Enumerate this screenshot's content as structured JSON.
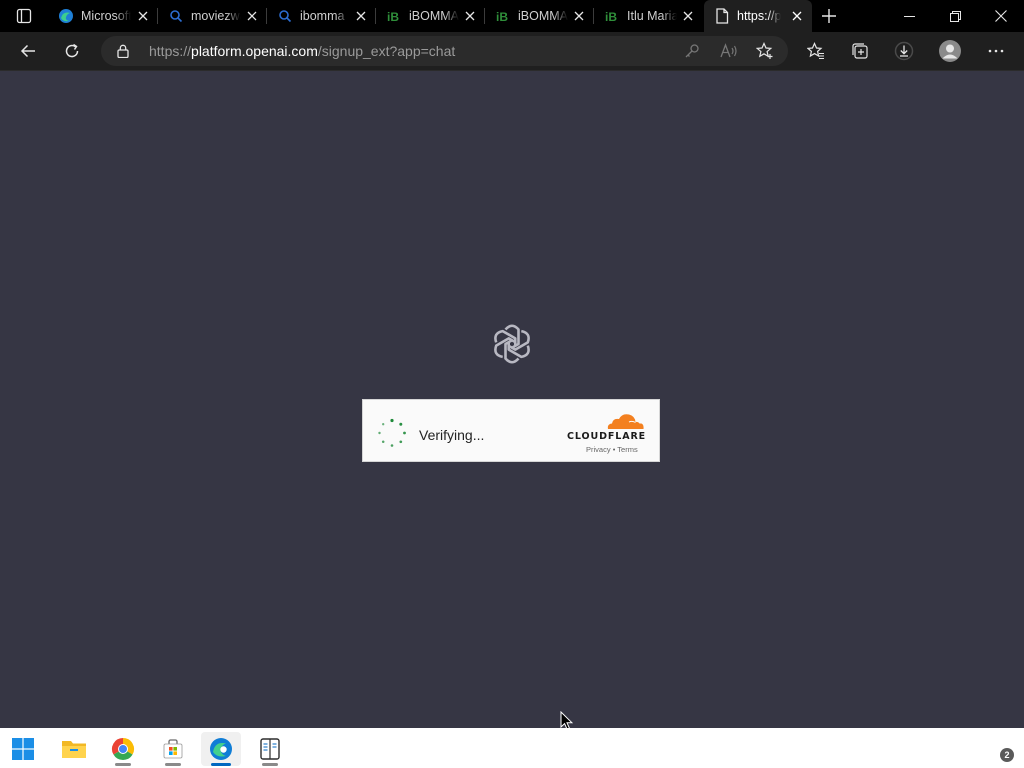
{
  "browser": {
    "tabs": [
      {
        "title": "Microsoft",
        "favicon": "edge-icon",
        "active": false
      },
      {
        "title": "moviezwap",
        "favicon": "search-icon",
        "active": false
      },
      {
        "title": "ibomma",
        "favicon": "search-icon",
        "active": false
      },
      {
        "title": "iBOMMA",
        "favicon": "ibomma-icon",
        "active": false
      },
      {
        "title": "iBOMMA",
        "favicon": "ibomma-icon",
        "active": false
      },
      {
        "title": "Itlu Maria",
        "favicon": "ibomma-icon",
        "active": false
      },
      {
        "title": "https://platform",
        "favicon": "page-icon",
        "active": true
      }
    ],
    "address": {
      "scheme": "https://",
      "host": "platform.openai.com",
      "path": "/signup_ext?app=chat"
    }
  },
  "page": {
    "verify_text": "Verifying...",
    "cf_brand": "CLOUDFLARE",
    "cf_privacy": "Privacy",
    "cf_sep": "•",
    "cf_terms": "Terms"
  },
  "taskbar": {
    "apps": [
      "start-button",
      "file-explorer",
      "chrome",
      "microsoft-store",
      "edge",
      "reader-app"
    ],
    "notification_count": "2"
  },
  "colors": {
    "page_bg": "#363644",
    "tabstrip_bg": "#000000",
    "toolbar_bg": "#1f1f1f",
    "cloudflare_orange": "#f38020",
    "spinner_green": "#1f8a3a"
  }
}
